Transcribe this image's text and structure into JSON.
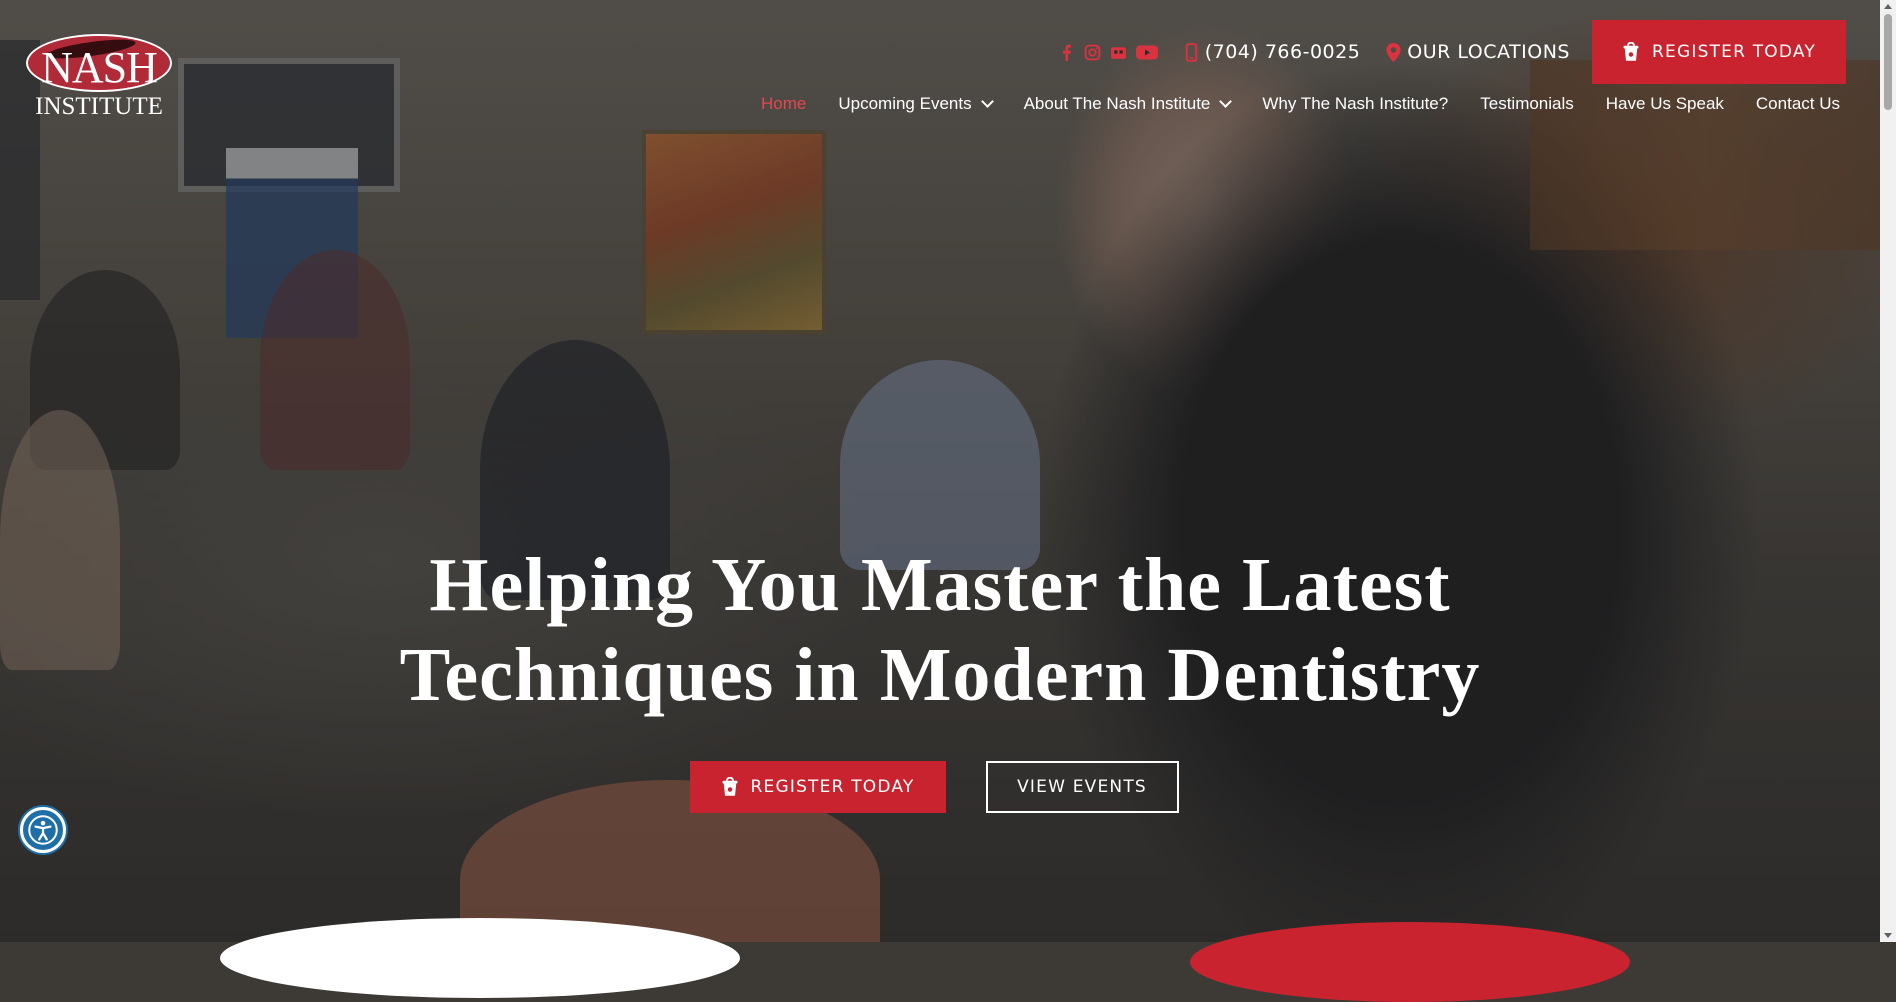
{
  "brand": {
    "logo_line1": "NASH",
    "logo_line2": "INSTITUTE",
    "accent_color": "#c8232f"
  },
  "topbar": {
    "social_icons": [
      "facebook-icon",
      "instagram-icon",
      "podcast-icon",
      "youtube-icon"
    ],
    "phone": "(704) 766-0025",
    "locations_label": "OUR LOCATIONS",
    "register_label": "REGISTER TODAY"
  },
  "nav": {
    "items": [
      {
        "label": "Home",
        "active": true
      },
      {
        "label": "Upcoming Events",
        "dropdown": true
      },
      {
        "label": "About The Nash Institute",
        "dropdown": true
      },
      {
        "label": "Why The Nash Institute?"
      },
      {
        "label": "Testimonials"
      },
      {
        "label": "Have Us Speak"
      },
      {
        "label": "Contact Us"
      }
    ]
  },
  "hero": {
    "headline_line1": "Helping You Master the Latest",
    "headline_line2": "Techniques in Modern Dentistry",
    "register_label": "REGISTER TODAY",
    "view_events_label": "VIEW EVENTS"
  }
}
